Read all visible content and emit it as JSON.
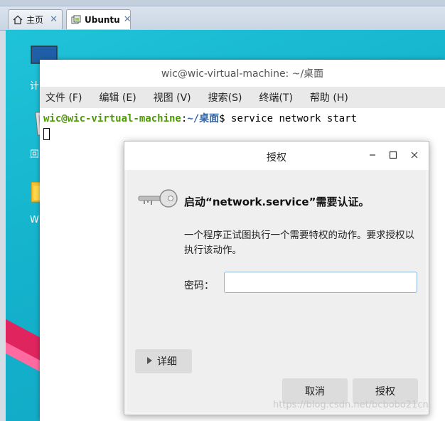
{
  "vm_tabs": [
    {
      "label": "主页",
      "icon": "home-icon"
    },
    {
      "label": "Ubuntu",
      "icon": "vm-icon"
    }
  ],
  "tab_close_glyph": "✕",
  "desktop": {
    "labels": [
      "计",
      "回",
      "W"
    ]
  },
  "terminal": {
    "title": "wic@wic-virtual-machine: ~/桌面",
    "menu": [
      "文件 (F)",
      "编辑 (E)",
      "视图 (V)",
      "搜索(S)",
      "终端(T)",
      "帮助 (H)"
    ],
    "prompt_user": "wic@wic-virtual-machine",
    "prompt_sep": ":",
    "prompt_path": "~/桌面",
    "prompt_symbol": "$ ",
    "command": "service network start"
  },
  "dialog": {
    "title": "授权",
    "heading": "启动“network.service”需要认证。",
    "message": "一个程序正试图执行一个需要特权的动作。要求授权以执行该动作。",
    "password_label": "密码：",
    "password_value": "",
    "details_label": "详细",
    "cancel_label": "取消",
    "authorize_label": "授权",
    "icon": "key-icon"
  },
  "watermark": "https://blog.csdn.net/bcbobo21cn"
}
